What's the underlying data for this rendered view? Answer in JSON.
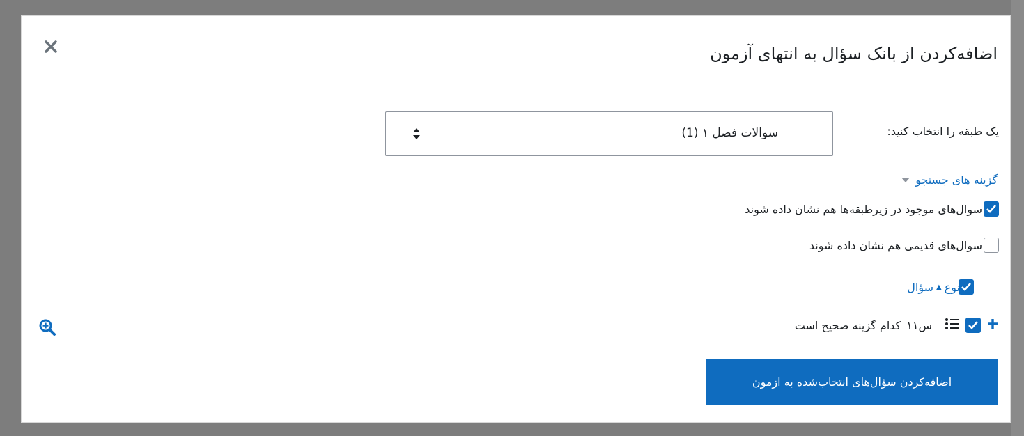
{
  "dialog": {
    "title": "اضافه‌کردن از بانک سؤال به انتهای آزمون"
  },
  "category": {
    "label": "یک طبقه را انتخاب کنید:",
    "selected": "سوالات فصل ۱ (1)"
  },
  "search_options": {
    "toggle_label": "گزینه های جستجو"
  },
  "options": {
    "show_subcategories": {
      "label": "سوال‌های موجود در زیرطبقه‌ها هم نشان داده شوند",
      "checked": true
    },
    "show_old": {
      "label": "سوال‌های قدیمی هم نشان داده شوند",
      "checked": false
    }
  },
  "table": {
    "type_header": "نوع",
    "question_header": "سؤال",
    "rows": [
      {
        "name": "س۱۱",
        "text": "کدام گزینه صحیح است",
        "checked": true
      }
    ]
  },
  "actions": {
    "add_selected": "اضافه‌کردن سؤال‌های انتخاب‌شده به ازمون"
  },
  "colors": {
    "primary": "#0f6cbf",
    "text": "#1d2125",
    "overlay": "#7d7d7d"
  }
}
